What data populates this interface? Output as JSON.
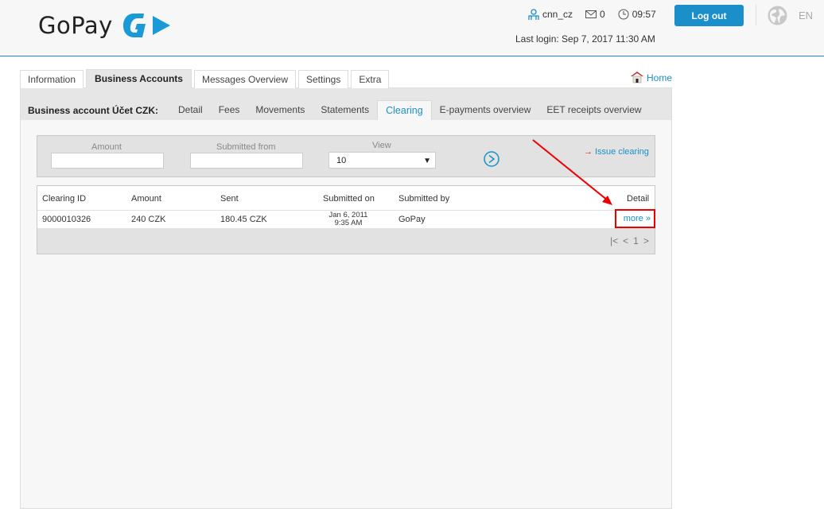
{
  "brand": {
    "name": "GoPay",
    "accent": "#1a8fc9"
  },
  "header": {
    "username": "cnn_cz",
    "messages_count": "0",
    "time": "09:57",
    "last_login": "Last login: Sep 7, 2017 11:30 AM",
    "logout_label": "Log out",
    "language": "EN"
  },
  "main_tabs": [
    {
      "label": "Information",
      "active": false
    },
    {
      "label": "Business Accounts",
      "active": true
    },
    {
      "label": "Messages Overview",
      "active": false
    },
    {
      "label": "Settings",
      "active": false
    },
    {
      "label": "Extra",
      "active": false
    }
  ],
  "home_label": "Home",
  "subnav": {
    "title": "Business account Účet CZK:",
    "tabs": [
      {
        "label": "Detail",
        "active": false
      },
      {
        "label": "Fees",
        "active": false
      },
      {
        "label": "Movements",
        "active": false
      },
      {
        "label": "Statements",
        "active": false
      },
      {
        "label": "Clearing",
        "active": true
      },
      {
        "label": "E-payments overview",
        "active": false
      },
      {
        "label": "EET receipts overview",
        "active": false
      }
    ]
  },
  "filter": {
    "amount_label": "Amount",
    "amount_value": "",
    "submitted_from_label": "Submitted from",
    "submitted_from_value": "",
    "view_label": "View",
    "view_value": "10",
    "issue_clearing_label": "Issue clearing"
  },
  "table": {
    "headers": [
      "Clearing ID",
      "Amount",
      "Sent",
      "Submitted on",
      "Submitted by",
      "Detail"
    ],
    "rows": [
      {
        "clearing_id": "9000010326",
        "amount": "240 CZK",
        "sent": "180.45 CZK",
        "submitted_date": "Jan 6, 2011",
        "submitted_time": "9:35 AM",
        "submitted_by": "GoPay",
        "detail": "more »"
      }
    ],
    "pagination": {
      "current_page": "1"
    }
  }
}
